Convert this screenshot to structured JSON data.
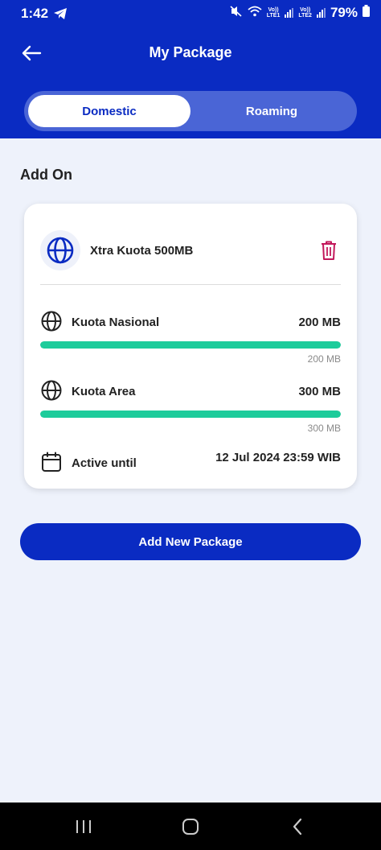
{
  "status_bar": {
    "time": "1:42",
    "battery": "79%",
    "sim1": "LTE1",
    "sim2": "LTE2",
    "volte": "Vo))"
  },
  "header": {
    "title": "My Package",
    "tabs": [
      {
        "label": "Domestic",
        "active": true
      },
      {
        "label": "Roaming",
        "active": false
      }
    ]
  },
  "section": {
    "title": "Add On"
  },
  "package": {
    "name": "Xtra Kuota 500MB",
    "icon": "globe-icon",
    "quotas": [
      {
        "label": "Kuota Nasional",
        "value": "200 MB",
        "remaining": "200 MB",
        "fill_fraction": 1.0
      },
      {
        "label": "Kuota Area",
        "value": "300 MB",
        "remaining": "300 MB",
        "fill_fraction": 1.0
      }
    ],
    "active_until_label": "Active until",
    "active_until_value": "12 Jul 2024 23:59 WIB"
  },
  "actions": {
    "add_label": "Add New Package"
  },
  "colors": {
    "brand": "#0a2bc2",
    "progress": "#1dcc9b",
    "delete": "#c2185b"
  }
}
